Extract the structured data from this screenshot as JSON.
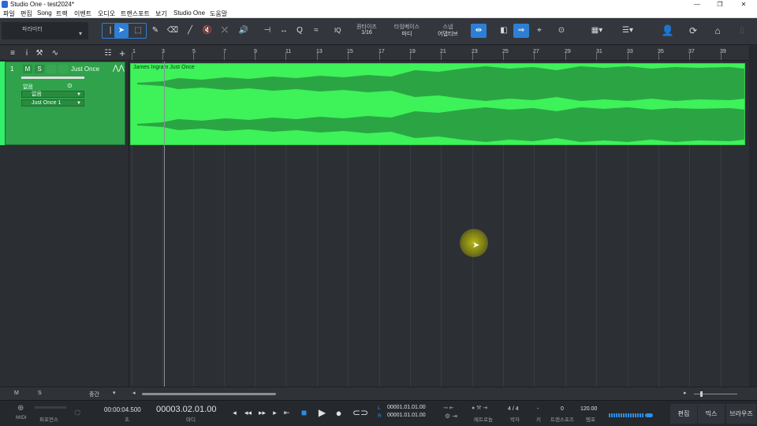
{
  "window": {
    "title": "Studio One - test2024*",
    "min_label": "—",
    "max_label": "❐",
    "close_label": "✕"
  },
  "menu": [
    "파일",
    "편집",
    "Song",
    "트랙",
    "이벤트",
    "오디오",
    "트랜스포트",
    "보기",
    "Studio One",
    "도움말"
  ],
  "toolbar": {
    "param_label": "파라미터",
    "iq_label": "IQ",
    "quantize_label": "퀀타이즈",
    "quantize_value": "1/16",
    "timebase_label": "타임베이스",
    "timebase_value": "마디",
    "snap_label": "스냅",
    "snap_value": "어댑티브"
  },
  "track": {
    "number": "1",
    "mute": "M",
    "solo": "S",
    "name": "Just Once",
    "input_label": "없음",
    "output_label": "없음",
    "playlist_label": "Just Once 1",
    "color": "#30a24c"
  },
  "ruler": {
    "bars": [
      "1",
      "3",
      "5",
      "7",
      "9",
      "11",
      "13",
      "15",
      "17",
      "19",
      "21",
      "23",
      "25",
      "27",
      "29",
      "31",
      "33",
      "35",
      "37",
      "39"
    ]
  },
  "clip": {
    "name": "James Ingram Just Once",
    "color": "#3ef25a"
  },
  "bottom_bar": {
    "m_label": "M",
    "s_label": "S",
    "size_label": "중간"
  },
  "transport": {
    "midi_label": "MIDI",
    "perf_label": "퍼포먼스",
    "time_seconds": "00:00:04.500",
    "time_seconds_unit": "초",
    "time_bars": "00003.02.01.00",
    "time_bars_unit": "마디",
    "loop_l_label": "L",
    "loop_r_label": "R",
    "loop_l_value": "00001.01.01.00",
    "loop_r_value": "00001.01.01.00",
    "metronome_label": "메트로놈",
    "signature_value": "4 / 4",
    "signature_label": "박자",
    "key_value": "-",
    "key_label": "키",
    "transpose_value": "0",
    "transpose_label": "트랜스포즈",
    "tempo_value": "120.00",
    "tempo_label": "템포",
    "tab_edit": "편집",
    "tab_mix": "믹스",
    "tab_browse": "브라우즈"
  }
}
